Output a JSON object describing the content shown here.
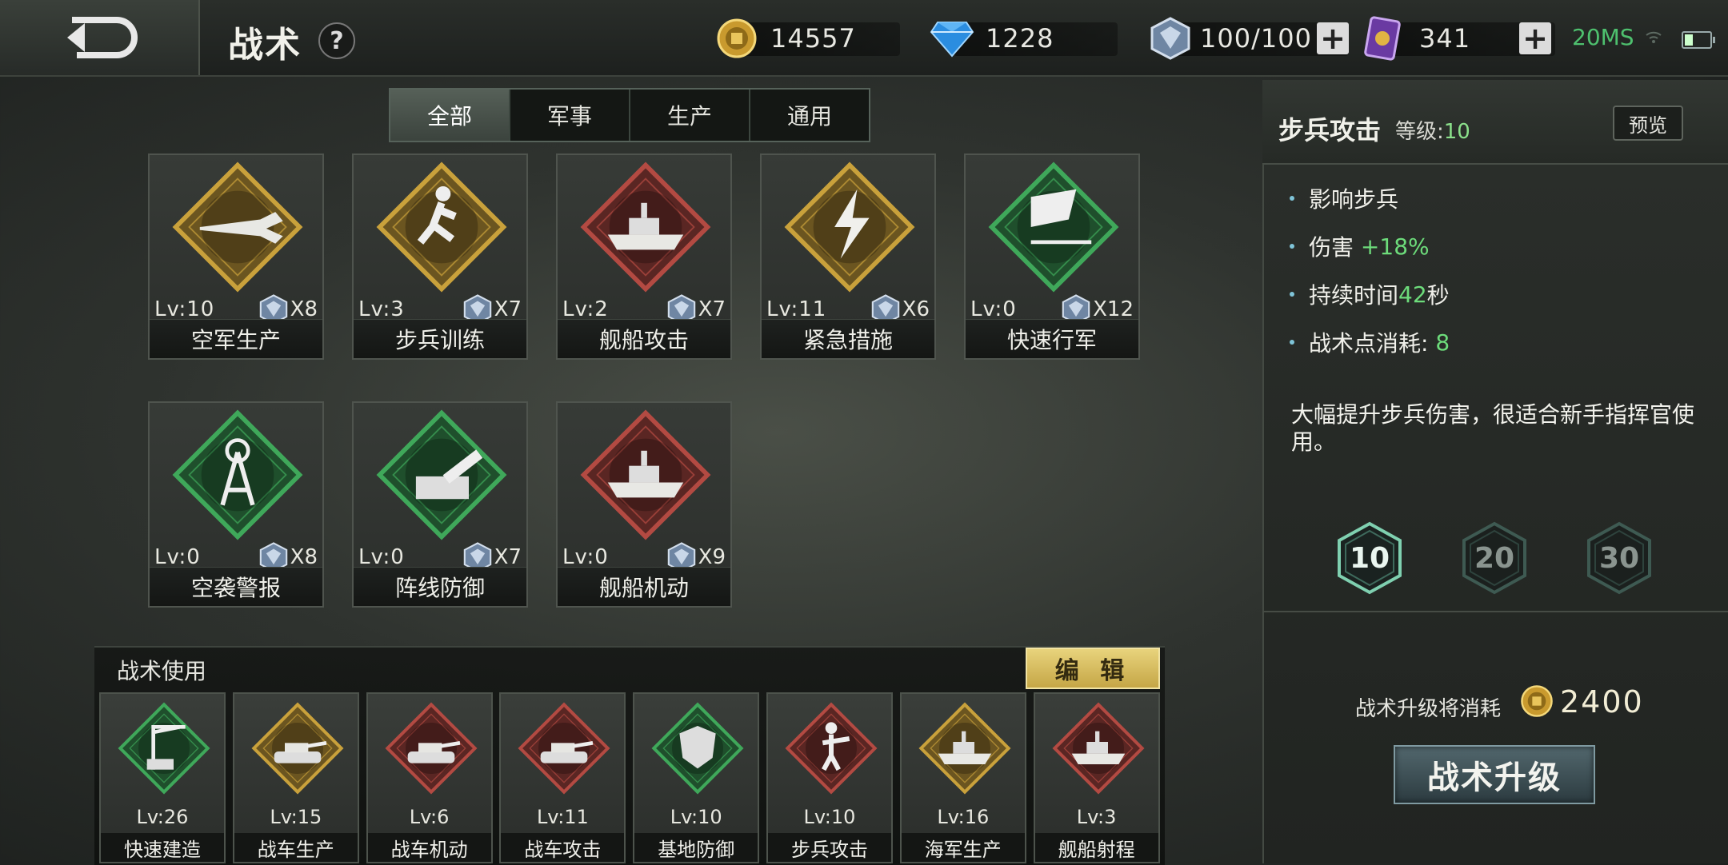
{
  "header": {
    "title": "战术",
    "help": "?",
    "gold": "14557",
    "diamonds": "1228",
    "points": "100/100",
    "cards": "341",
    "ping": "20MS"
  },
  "tabs": [
    "全部",
    "军事",
    "生产",
    "通用"
  ],
  "skills": [
    {
      "name": "空军生产",
      "level": "Lv:10",
      "cost": "X8"
    },
    {
      "name": "步兵训练",
      "level": "Lv:3",
      "cost": "X7"
    },
    {
      "name": "舰船攻击",
      "level": "Lv:2",
      "cost": "X7"
    },
    {
      "name": "紧急措施",
      "level": "Lv:11",
      "cost": "X6"
    },
    {
      "name": "快速行军",
      "level": "Lv:0",
      "cost": "X12"
    },
    {
      "name": "空袭警报",
      "level": "Lv:0",
      "cost": "X8"
    },
    {
      "name": "阵线防御",
      "level": "Lv:0",
      "cost": "X7"
    },
    {
      "name": "舰船机动",
      "level": "Lv:0",
      "cost": "X9"
    }
  ],
  "usage": {
    "title": "战术使用",
    "edit": "编 辑",
    "items": [
      {
        "name": "快速建造",
        "level": "Lv:26"
      },
      {
        "name": "战车生产",
        "level": "Lv:15"
      },
      {
        "name": "战车机动",
        "level": "Lv:6"
      },
      {
        "name": "战车攻击",
        "level": "Lv:11"
      },
      {
        "name": "基地防御",
        "level": "Lv:10"
      },
      {
        "name": "步兵攻击",
        "level": "Lv:10"
      },
      {
        "name": "海军生产",
        "level": "Lv:16"
      },
      {
        "name": "舰船射程",
        "level": "Lv:3"
      }
    ]
  },
  "detail": {
    "name": "步兵攻击",
    "level_label": "等级:",
    "level": "10",
    "preview": "预览",
    "effects": [
      {
        "label": "影响步兵",
        "value": ""
      },
      {
        "label": "伤害 ",
        "value": "+18%"
      },
      {
        "label": "持续时间",
        "value": "42",
        "suffix": "秒"
      },
      {
        "label": "战术点消耗: ",
        "value": "8"
      }
    ],
    "description": "大幅提升步兵伤害，很适合新手指挥官使用。",
    "levels": [
      "10",
      "20",
      "30"
    ],
    "upgrade_cost_label": "战术升级将消耗",
    "upgrade_cost": "2400",
    "upgrade_button": "战术升级"
  },
  "colors": {
    "gold": "#c9a13b",
    "green": "#2f8a45",
    "red": "#8a3a35",
    "accent_green_text": "#6ddc7b"
  }
}
